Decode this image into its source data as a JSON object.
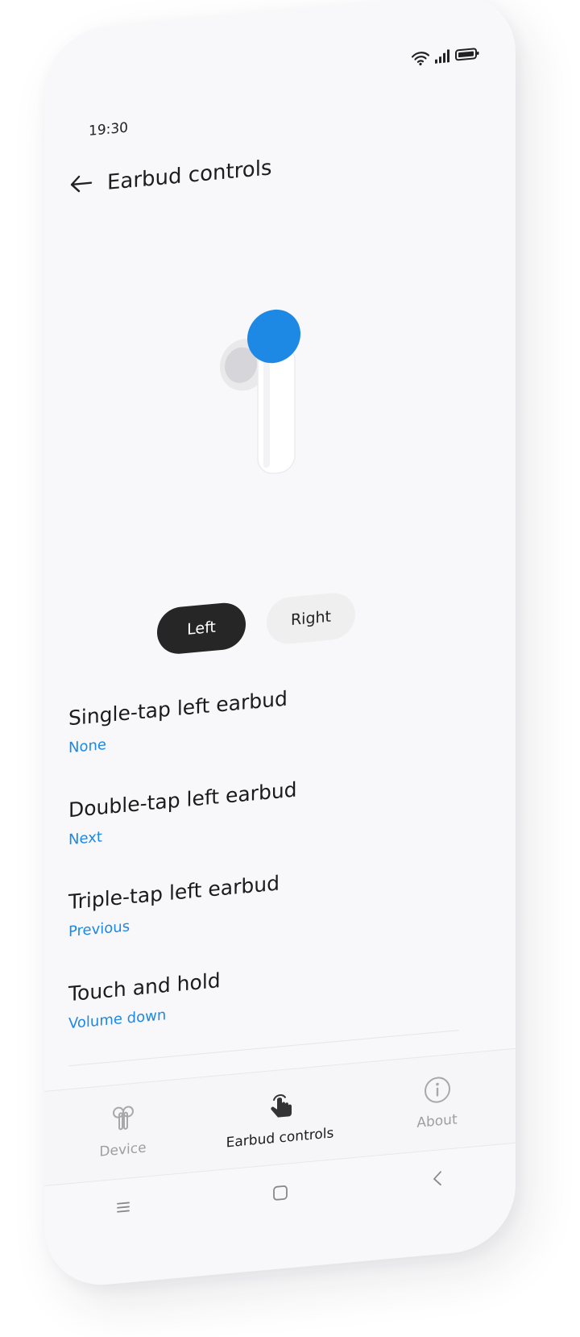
{
  "status_bar": {
    "time": "19:30",
    "icons": [
      "wifi-icon",
      "signal-icon",
      "battery-icon"
    ]
  },
  "header": {
    "back_icon": "back-arrow-icon",
    "title": "Earbud controls"
  },
  "hero": {
    "image": "earbud-illustration",
    "highlight_color": "#1e88e5"
  },
  "segment": {
    "left_label": "Left",
    "right_label": "Right",
    "selected": "Left"
  },
  "settings": [
    {
      "title": "Single-tap left earbud",
      "value": "None"
    },
    {
      "title": "Double-tap left earbud",
      "value": "Next"
    },
    {
      "title": "Triple-tap left earbud",
      "value": "Previous"
    },
    {
      "title": "Touch and hold",
      "value": "Volume down"
    }
  ],
  "tabs": [
    {
      "label": "Device",
      "icon": "earbuds-icon",
      "active": false
    },
    {
      "label": "Earbud controls",
      "icon": "touch-hand-icon",
      "active": true
    },
    {
      "label": "About",
      "icon": "info-icon",
      "active": false
    }
  ],
  "nav": {
    "menu_icon": "menu-icon",
    "home_icon": "home-icon",
    "back_icon": "nav-back-icon"
  },
  "colors": {
    "accent": "#1e88e5",
    "active_segment": "#262626",
    "background": "#f8f8fa"
  }
}
